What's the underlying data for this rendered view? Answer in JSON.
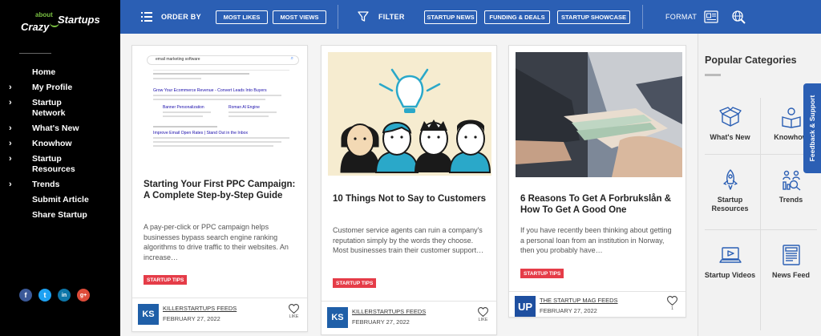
{
  "brand": {
    "about": "about",
    "name_left": "Crazy",
    "name_right": "Startups"
  },
  "sidebar": {
    "items": [
      {
        "label": "Home",
        "has_children": false
      },
      {
        "label": "My Profile",
        "has_children": true
      },
      {
        "label": "Startup Network",
        "has_children": true
      },
      {
        "label": "What's New",
        "has_children": true
      },
      {
        "label": "Knowhow",
        "has_children": true
      },
      {
        "label": "Startup Resources",
        "has_children": true
      },
      {
        "label": "Trends",
        "has_children": true
      },
      {
        "label": "Submit Article",
        "has_children": false
      },
      {
        "label": "Share Startup",
        "has_children": false
      }
    ],
    "social": [
      {
        "icon": "facebook-icon",
        "glyph": "f",
        "color": "#3b5998"
      },
      {
        "icon": "twitter-icon",
        "glyph": "t",
        "color": "#1da1f2"
      },
      {
        "icon": "linkedin-icon",
        "glyph": "in",
        "color": "#0e76a8"
      },
      {
        "icon": "googleplus-icon",
        "glyph": "g+",
        "color": "#dd4b39"
      }
    ]
  },
  "topbar": {
    "order_by_label": "ORDER BY",
    "order_buttons": [
      "MOST LIKES",
      "MOST VIEWS"
    ],
    "filter_label": "FILTER",
    "filter_buttons": [
      "STARTUP NEWS",
      "FUNDING & DEALS",
      "STARTUP SHOWCASE"
    ],
    "format_label": "FORMAT",
    "accent": "#2b5fb4"
  },
  "cards": [
    {
      "title": "Starting Your First PPC Campaign: A Complete Step-by-Step Guide",
      "excerpt": "A pay-per-click or PPC campaign helps businesses bypass search engine ranking algorithms to drive traffic to their websites. An increase…",
      "tag": "STARTUP TIPS",
      "source": "KILLERSTARTUPS FEEDS",
      "date": "FEBRUARY 27, 2022",
      "like_label": "LIKE",
      "logo": "KS",
      "image_text": {
        "query": "email marketing software",
        "ad1_title": "Grow Your Ecommerce Revenue - Convert Leads Into Buyers",
        "ad1_link_a": "Banner Personalization",
        "ad1_link_b": "Roman AI Engine",
        "ad2_title": "Improve Email Open Rates | Stand Out in the Inbox"
      }
    },
    {
      "title": "10 Things Not to Say to Customers",
      "excerpt": "Customer service agents can ruin a company's reputation simply by the words they choose. Most businesses train their customer support…",
      "tag": "STARTUP TIPS",
      "source": "KILLERSTARTUPS FEEDS",
      "date": "FEBRUARY 27, 2022",
      "like_label": "LIKE",
      "logo": "KS"
    },
    {
      "title": "6 Reasons To Get A Forbrukslån & How To Get A Good One",
      "excerpt": "If you have recently been thinking about getting a personal loan from an institution in Norway, then you probably have…",
      "tag": "STARTUP TIPS",
      "source": "THE STARTUP MAG FEEDS",
      "date": "FEBRUARY 27, 2022",
      "like_count": "1",
      "logo": "UP"
    }
  ],
  "categories": {
    "title": "Popular Categories",
    "items": [
      "What's New",
      "Knowhow",
      "Startup Resources",
      "Trends",
      "Startup Videos",
      "News Feed"
    ]
  },
  "feedback": "Feedback & Support"
}
